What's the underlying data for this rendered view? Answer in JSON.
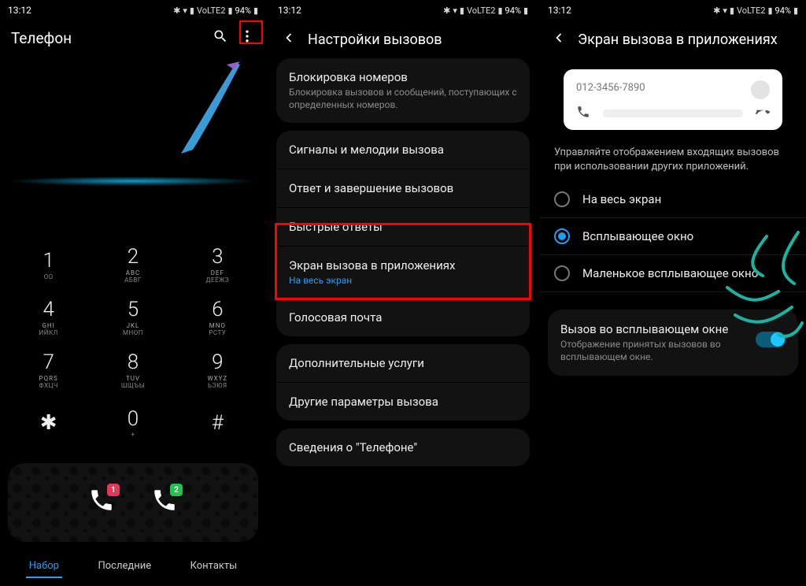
{
  "status": {
    "time": "13:12",
    "battery": "94%",
    "vol_label": "VoLTE2"
  },
  "s1": {
    "title": "Телефон",
    "tabs": [
      "Набор",
      "Последние",
      "Контакты"
    ],
    "active_tab": 0,
    "keys": [
      {
        "d": "1",
        "u": "",
        "l": "ОО"
      },
      {
        "d": "2",
        "u": "ABC",
        "l": "АБВГ"
      },
      {
        "d": "3",
        "u": "DEF",
        "l": "ДЕЁЖЗ"
      },
      {
        "d": "4",
        "u": "GHI",
        "l": "ИЙКЛ"
      },
      {
        "d": "5",
        "u": "JKL",
        "l": "МНОП"
      },
      {
        "d": "6",
        "u": "MNO",
        "l": "РСТУ"
      },
      {
        "d": "7",
        "u": "PQRS",
        "l": "ФХЦЧ"
      },
      {
        "d": "8",
        "u": "TUV",
        "l": "ШЩЪЫ"
      },
      {
        "d": "9",
        "u": "WXYZ",
        "l": "ЬЭЮЯ"
      },
      {
        "d": "✱",
        "u": "",
        "l": ""
      },
      {
        "d": "0",
        "u": "",
        "l": "+"
      },
      {
        "d": "#",
        "u": "",
        "l": ""
      }
    ],
    "call_badges": [
      "1",
      "2"
    ]
  },
  "s2": {
    "title": "Настройки вызовов",
    "block": {
      "t": "Блокировка номеров",
      "s": "Блокировка вызовов и сообщений, поступающих с определенных номеров."
    },
    "rows1": [
      "Сигналы и мелодии вызова",
      "Ответ и завершение вызовов",
      "Быстрые ответы"
    ],
    "callscreen": {
      "t": "Экран вызова в приложениях",
      "s": "На весь экран"
    },
    "voicemail": "Голосовая почта",
    "rows2": [
      "Дополнительные услуги",
      "Другие параметры вызова"
    ],
    "about": "Сведения о \"Телефоне\""
  },
  "s3": {
    "title": "Экран вызова в приложениях",
    "preview_num": "012-3456-7890",
    "help": "Управляйте отображением входящих вызовов при использовании других приложений.",
    "options": [
      "На весь экран",
      "Всплывающее окно",
      "Маленькое всплывающее окно"
    ],
    "selected": 1,
    "toggle": {
      "t": "Вызов во всплывающем окне",
      "s": "Отображение принятых вызовов во всплывающем окне.",
      "on": true
    }
  }
}
